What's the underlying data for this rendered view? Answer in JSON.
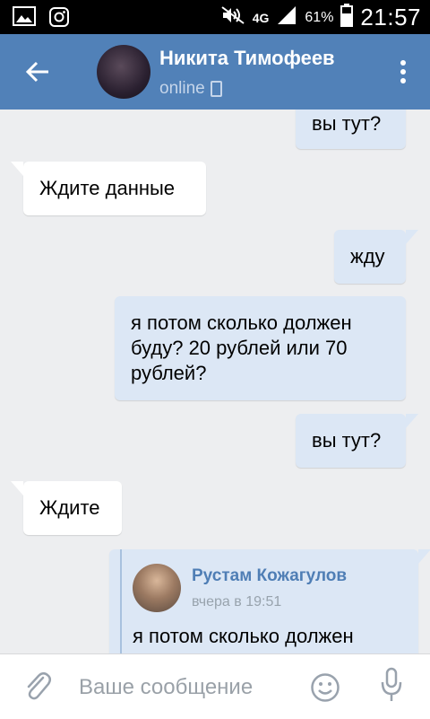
{
  "statusbar": {
    "network": "4G",
    "battery": "61%",
    "time": "21:57"
  },
  "header": {
    "contact_name": "Никита Тимофеев",
    "status": "online"
  },
  "messages": [
    {
      "direction": "out",
      "text": "вы тут?"
    },
    {
      "direction": "in",
      "text": "Ждите данные"
    },
    {
      "direction": "out",
      "text": "жду"
    },
    {
      "direction": "out",
      "text": "я потом сколько должен буду?  20 рублей или 70 рублей?"
    },
    {
      "direction": "out",
      "text": "вы тут?"
    },
    {
      "direction": "in",
      "text": "Ждите"
    }
  ],
  "forwarded": {
    "author": "Рустам Кожагулов",
    "time": "вчера в 19:51",
    "text": "я потом сколько должен"
  },
  "input": {
    "placeholder": "Ваше сообщение"
  }
}
